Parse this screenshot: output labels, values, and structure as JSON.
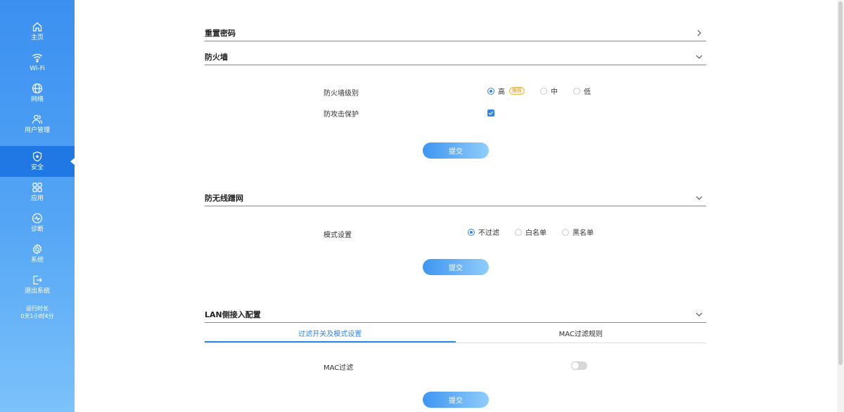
{
  "sidebar": {
    "items": [
      {
        "label": "主页",
        "icon": "home-icon"
      },
      {
        "label": "Wi-Fi",
        "icon": "wifi-icon"
      },
      {
        "label": "网络",
        "icon": "globe-icon"
      },
      {
        "label": "用户管理",
        "icon": "users-icon"
      },
      {
        "label": "安全",
        "icon": "shield-icon"
      },
      {
        "label": "应用",
        "icon": "grid-icon"
      },
      {
        "label": "诊断",
        "icon": "pulse-icon"
      },
      {
        "label": "系统",
        "icon": "gear-icon"
      },
      {
        "label": "退出系统",
        "icon": "logout-icon"
      }
    ],
    "active_index": 4,
    "uptime_label": "运行时长",
    "uptime_value": "0天1小时4分"
  },
  "sections": {
    "reset_password": {
      "title": "重置密码"
    },
    "firewall": {
      "title": "防火墙",
      "level_label": "防火墙级别",
      "levels": [
        "高",
        "中",
        "低"
      ],
      "selected_level": "高",
      "recommend_badge": "推荐",
      "attack_label": "防攻击保护",
      "attack_checked": true,
      "submit_label": "提交"
    },
    "anti_wifi": {
      "title": "防无线蹭网",
      "mode_label": "模式设置",
      "modes": [
        "不过滤",
        "白名单",
        "黑名单"
      ],
      "selected_mode": "不过滤",
      "submit_label": "提交"
    },
    "lan_access": {
      "title": "LAN侧接入配置",
      "tabs": [
        "过滤开关及模式设置",
        "MAC过滤规则"
      ],
      "active_tab": 0,
      "mac_label": "MAC过滤",
      "mac_enabled": false,
      "submit_label": "提交"
    }
  },
  "colors": {
    "accent": "#2f86ec",
    "sidebar_top": "#3b8ff0",
    "sidebar_active": "#1f78e3",
    "badge": "#e09a1e"
  }
}
